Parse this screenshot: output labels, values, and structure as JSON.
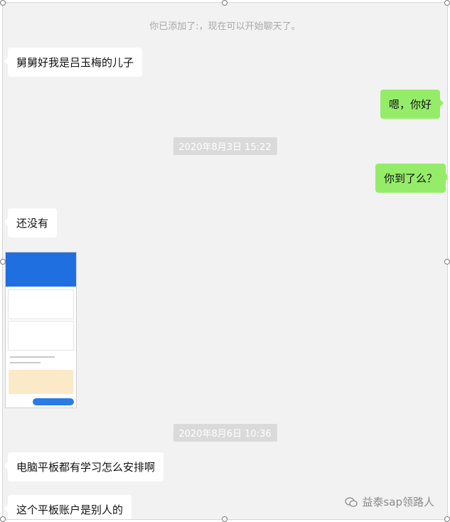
{
  "system_message": "你已添加了:，现在可以开始聊天了。",
  "timestamps": [
    "2020年8月3日 15:22",
    "2020年8月6日 10:36"
  ],
  "messages": [
    {
      "side": "left",
      "text": "舅舅好我是吕玉梅的儿子"
    },
    {
      "side": "right",
      "text": "嗯，你好"
    },
    {
      "side": "right",
      "text": "你到了么？"
    },
    {
      "side": "left",
      "text": "还没有"
    },
    {
      "side": "left",
      "text": "电脑平板都有学习怎么安排啊"
    },
    {
      "side": "left",
      "text": "这个平板账户是别人的"
    }
  ],
  "watermark": "益泰sap领路人",
  "colors": {
    "background": "#f2f2f2",
    "bubble_self": "#95ec69",
    "bubble_other": "#ffffff"
  }
}
